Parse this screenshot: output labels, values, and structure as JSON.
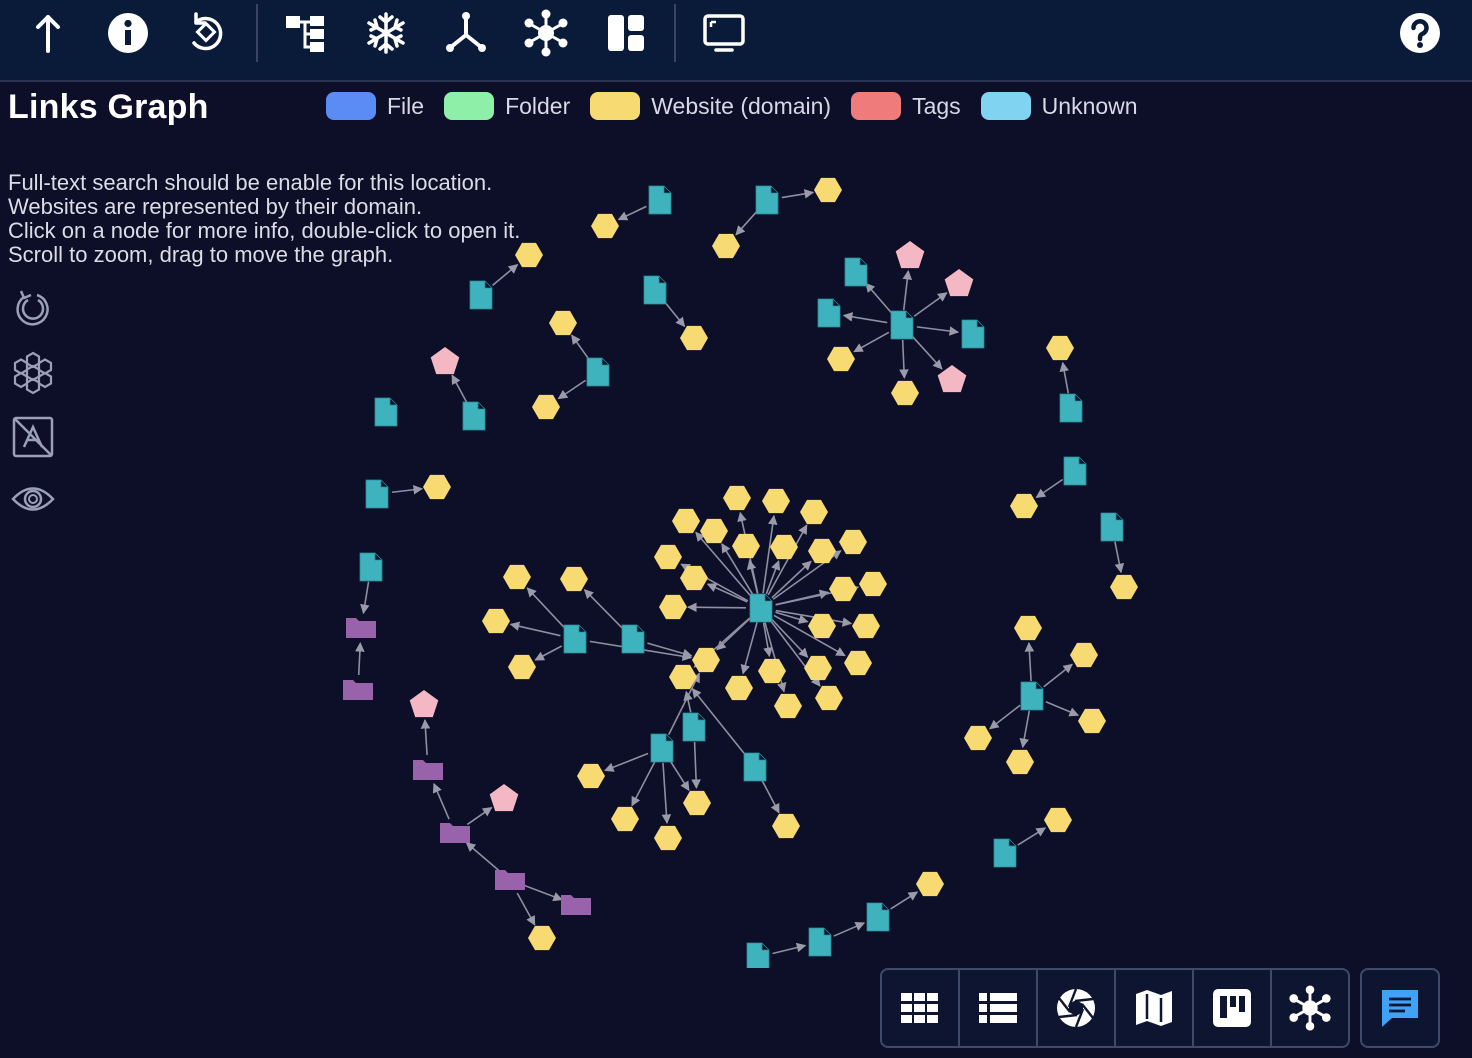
{
  "toolbar": {
    "buttons": [
      {
        "name": "go-up-button",
        "icon": "arrow-up-icon"
      },
      {
        "name": "info-button",
        "icon": "info-icon"
      },
      {
        "name": "reload-button",
        "icon": "rotate-icon"
      },
      {
        "name": "tree-view-button",
        "icon": "tree-icon"
      },
      {
        "name": "snowflake-button",
        "icon": "snowflake-icon"
      },
      {
        "name": "hierarchy-button",
        "icon": "fork-icon"
      },
      {
        "name": "network-button",
        "icon": "network-icon"
      },
      {
        "name": "layout-button",
        "icon": "layout-icon"
      },
      {
        "name": "fullscreen-button",
        "icon": "monitor-icon"
      },
      {
        "name": "help-button",
        "icon": "question-icon"
      }
    ]
  },
  "page": {
    "title": "Links Graph",
    "help_lines": [
      "Full-text search should be enable for this location.",
      "Websites are represented by their domain.",
      "Click on a node for more info, double-click to open it.",
      "Scroll to zoom, drag to move the graph."
    ]
  },
  "legend": [
    {
      "label": "File",
      "color": "#5b8cf5"
    },
    {
      "label": "Folder",
      "color": "#8ef0a8"
    },
    {
      "label": "Website (domain)",
      "color": "#f7da71"
    },
    {
      "label": "Tags",
      "color": "#ef7b7b"
    },
    {
      "label": "Unknown",
      "color": "#80d4f2"
    }
  ],
  "node_colors": {
    "file": "#3fb3bd",
    "folder": "#9863aa",
    "website": "#f7da71",
    "tag": "#f4b8c5",
    "edge": "#8f8fa2"
  },
  "side_controls": [
    {
      "name": "reset-graph-button",
      "icon": "refresh-icon"
    },
    {
      "name": "cluster-button",
      "icon": "hexagon-cluster-icon"
    },
    {
      "name": "toggle-labels-button",
      "icon": "no-text-icon"
    },
    {
      "name": "visibility-button",
      "icon": "eye-icon"
    }
  ],
  "bottom_bar": [
    {
      "name": "grid-view-button",
      "icon": "grid-icon"
    },
    {
      "name": "list-view-button",
      "icon": "list-icon"
    },
    {
      "name": "gallery-view-button",
      "icon": "aperture-icon"
    },
    {
      "name": "map-view-button",
      "icon": "map-icon"
    },
    {
      "name": "kanban-view-button",
      "icon": "kanban-icon"
    },
    {
      "name": "graph-view-button",
      "icon": "graph-icon"
    }
  ],
  "chat": {
    "icon": "chat-icon"
  }
}
